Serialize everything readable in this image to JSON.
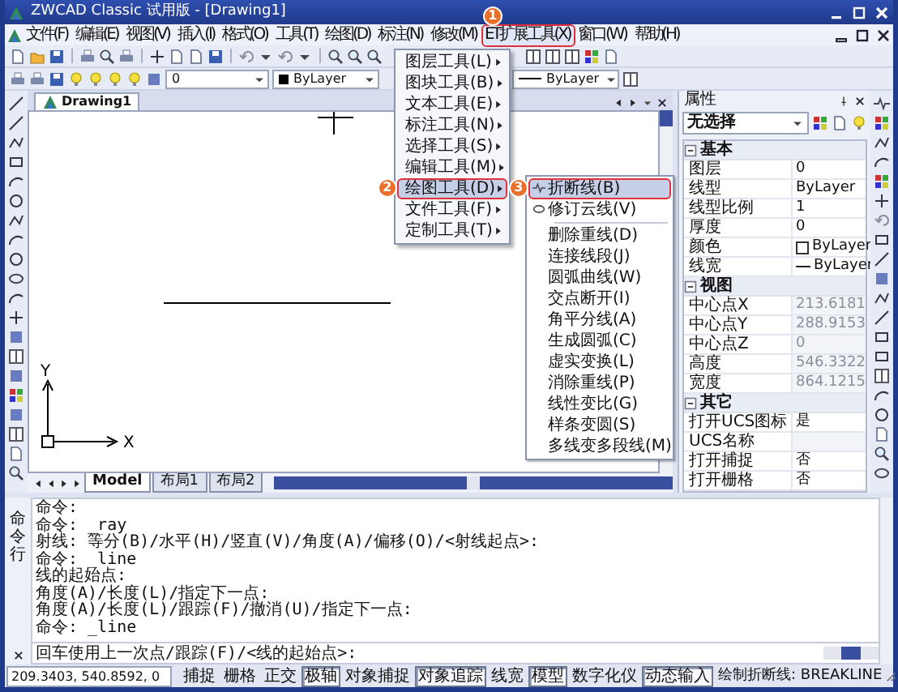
{
  "window": {
    "title": "ZWCAD Classic 试用版 - [Drawing1]"
  },
  "menu_bar": [
    {
      "label": "文件(F)",
      "selected": false
    },
    {
      "label": "编辑(E)",
      "selected": false
    },
    {
      "label": "视图(V)",
      "selected": false
    },
    {
      "label": "插入(I)",
      "selected": false
    },
    {
      "label": "格式(O)",
      "selected": false
    },
    {
      "label": "工具(T)",
      "selected": false
    },
    {
      "label": "绘图(D)",
      "selected": false
    },
    {
      "label": "标注(N)",
      "selected": false
    },
    {
      "label": "修改(M)",
      "selected": false
    },
    {
      "label": "ET扩展工具(X)",
      "selected": true,
      "callout": "1",
      "dropdown": [
        {
          "label": "图层工具(L)",
          "selected": false
        },
        {
          "label": "图块工具(B)",
          "selected": false
        },
        {
          "label": "文本工具(E)",
          "selected": false
        },
        {
          "label": "标注工具(N)",
          "selected": false
        },
        {
          "label": "选择工具(S)",
          "selected": false
        },
        {
          "label": "编辑工具(M)",
          "selected": false
        },
        {
          "label": "绘图工具(D)",
          "selected": true,
          "callout": "2",
          "submenu": [
            {
              "items": [
                {
                  "label": "折断线(B)",
                  "selected": true,
                  "callout": "3",
                  "kind": "zigzag"
                },
                {
                  "label": "修订云线(V)",
                  "selected": false,
                  "kind": "ellipse"
                }
              ]
            },
            {
              "items": [
                {
                  "label": "删除重线(D)",
                  "selected": false,
                  "kind": "plain"
                },
                {
                  "label": "连接线段(J)",
                  "selected": false,
                  "kind": "plain"
                },
                {
                  "label": "圆弧曲线(W)",
                  "selected": false,
                  "kind": "plain"
                },
                {
                  "label": "交点断开(I)",
                  "selected": false,
                  "kind": "plain"
                },
                {
                  "label": "角平分线(A)",
                  "selected": false,
                  "kind": "plain"
                },
                {
                  "label": "生成圆弧(C)",
                  "selected": false,
                  "kind": "plain"
                },
                {
                  "label": "虚实变换(L)",
                  "selected": false,
                  "kind": "plain"
                },
                {
                  "label": "消除重线(P)",
                  "selected": false,
                  "kind": "plain"
                },
                {
                  "label": "线性变比(G)",
                  "selected": false,
                  "kind": "plain"
                },
                {
                  "label": "样条变圆(S)",
                  "selected": false,
                  "kind": "plain"
                },
                {
                  "label": "多线变多段线(M)",
                  "selected": false,
                  "kind": "plain"
                }
              ]
            }
          ]
        },
        {
          "label": "文件工具(F)",
          "selected": false
        },
        {
          "label": "定制工具(T)",
          "selected": false
        }
      ]
    },
    {
      "label": "窗口(W)",
      "selected": false
    },
    {
      "label": "帮助(H)",
      "selected": false
    }
  ],
  "toolbar": {
    "layer": "0",
    "color_setting": "ByLayer",
    "linetype": "ByLayer"
  },
  "document_tab": "Drawing1",
  "canvas": {
    "x_label": "X",
    "y_label": "Y"
  },
  "layout_tabs": [
    {
      "label": "Model",
      "selected": true
    },
    {
      "label": "布局1",
      "selected": false
    },
    {
      "label": "布局2",
      "selected": false
    }
  ],
  "properties": {
    "title": "属性",
    "selection": "无选择",
    "groups": [
      {
        "name": "基本",
        "rows": [
          {
            "name": "图层",
            "value": "0",
            "kind": "text",
            "disabled": false
          },
          {
            "name": "线型",
            "value": "ByLayer",
            "kind": "text",
            "disabled": false
          },
          {
            "name": "线型比例",
            "value": "1",
            "kind": "text",
            "disabled": false
          },
          {
            "name": "厚度",
            "value": "0",
            "kind": "text",
            "disabled": false
          },
          {
            "name": "颜色",
            "value": "ByLayer",
            "kind": "color",
            "disabled": false
          },
          {
            "name": "线宽",
            "value": "ByLayer",
            "kind": "lineweight",
            "disabled": false
          }
        ]
      },
      {
        "name": "视图",
        "rows": [
          {
            "name": "中心点X",
            "value": "213.6181",
            "kind": "text",
            "disabled": true
          },
          {
            "name": "中心点Y",
            "value": "288.9153",
            "kind": "text",
            "disabled": true
          },
          {
            "name": "中心点Z",
            "value": "0",
            "kind": "text",
            "disabled": true
          },
          {
            "name": "高度",
            "value": "546.3322",
            "kind": "text",
            "disabled": true
          },
          {
            "name": "宽度",
            "value": "864.1215",
            "kind": "text",
            "disabled": true
          }
        ]
      },
      {
        "name": "其它",
        "rows": [
          {
            "name": "打开UCS图标",
            "value": "是",
            "kind": "text",
            "disabled": false
          },
          {
            "name": "UCS名称",
            "kind": "text",
            "disabled": true
          },
          {
            "name": "打开捕捉",
            "value": "否",
            "kind": "text",
            "disabled": false
          },
          {
            "name": "打开栅格",
            "value": "否",
            "kind": "text",
            "disabled": false
          }
        ]
      }
    ]
  },
  "command_line": {
    "label": "命令行",
    "history": [
      "命令:",
      "命令: _ray",
      "射线: 等分(B)/水平(H)/竖直(V)/角度(A)/偏移(O)/<射线起点>:",
      "命令: _line",
      "线的起始点:",
      "角度(A)/长度(L)/指定下一点:",
      "角度(A)/长度(L)/跟踪(F)/撤消(U)/指定下一点:",
      "命令: _line"
    ],
    "prompt": "回车使用上一次点/跟踪(F)/<线的起始点>:"
  },
  "status_bar": {
    "coordinates": "209.3403, 540.8592, 0",
    "toggles": [
      {
        "label": "捕捉",
        "on": false
      },
      {
        "label": "栅格",
        "on": false
      },
      {
        "label": "正交",
        "on": false
      },
      {
        "label": "极轴",
        "on": true
      },
      {
        "label": "对象捕捉",
        "on": false
      },
      {
        "label": "对象追踪",
        "on": true
      },
      {
        "label": "线宽",
        "on": false
      },
      {
        "label": "模型",
        "on": true
      },
      {
        "label": "数字化仪",
        "on": false
      },
      {
        "label": "动态输入",
        "on": true
      }
    ],
    "hint": "绘制折断线: BREAKLINE"
  }
}
